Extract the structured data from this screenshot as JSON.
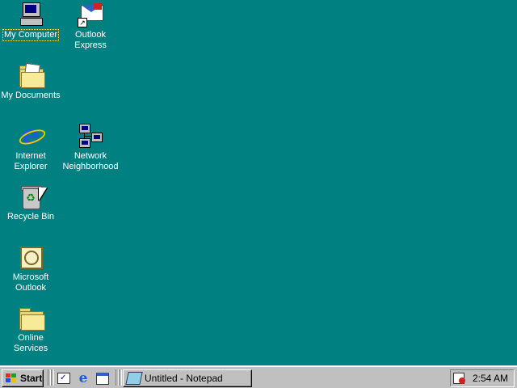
{
  "desktop": {
    "icons": [
      {
        "id": "my-computer",
        "label": "My Computer",
        "icon": "computer-icon"
      },
      {
        "id": "outlook-express",
        "label": "Outlook\nExpress",
        "icon": "outlook-express-icon"
      },
      {
        "id": "my-documents",
        "label": "My Documents",
        "icon": "folder-documents-icon"
      },
      {
        "id": "internet-explorer",
        "label": "Internet\nExplorer",
        "icon": "internet-explorer-icon"
      },
      {
        "id": "network-neighborhood",
        "label": "Network\nNeighborhood",
        "icon": "network-icon"
      },
      {
        "id": "recycle-bin",
        "label": "Recycle Bin",
        "icon": "recycle-bin-icon"
      },
      {
        "id": "microsoft-outlook",
        "label": "Microsoft\nOutlook",
        "icon": "outlook-icon"
      },
      {
        "id": "online-services",
        "label": "Online\nServices",
        "icon": "folder-icon"
      }
    ]
  },
  "taskbar": {
    "start_label": "Start",
    "quick_launch": [
      "show-desktop-icon",
      "internet-explorer-icon",
      "outlook-express-icon"
    ],
    "tasks": [
      {
        "label": "Untitled - Notepad",
        "icon": "notepad-icon"
      }
    ],
    "clock": "2:54 AM"
  },
  "colors": {
    "desktop": "#008080",
    "taskbar": "#c0c0c0"
  }
}
